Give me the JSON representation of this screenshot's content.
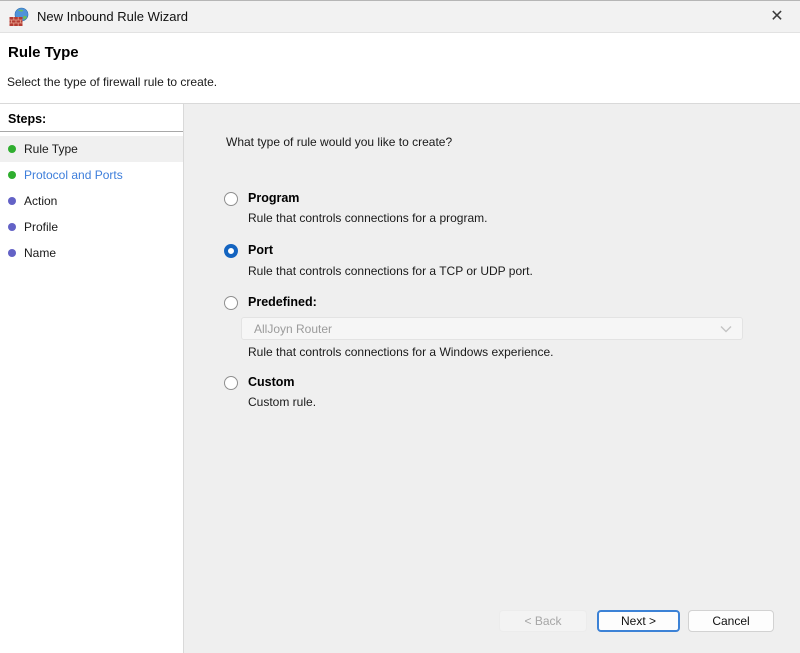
{
  "window": {
    "title": "New Inbound Rule Wizard",
    "close_glyph": "✕"
  },
  "header": {
    "title": "Rule Type",
    "subtitle": "Select the type of firewall rule to create."
  },
  "sidebar": {
    "heading": "Steps:",
    "steps": [
      {
        "label": "Rule Type",
        "bullet": "green",
        "state": "current"
      },
      {
        "label": "Protocol and Ports",
        "bullet": "green",
        "state": "link"
      },
      {
        "label": "Action",
        "bullet": "purple",
        "state": "upcoming"
      },
      {
        "label": "Profile",
        "bullet": "purple",
        "state": "upcoming"
      },
      {
        "label": "Name",
        "bullet": "purple",
        "state": "upcoming"
      }
    ]
  },
  "main": {
    "question": "What type of rule would you like to create?",
    "options": [
      {
        "label": "Program",
        "description": "Rule that controls connections for a program.",
        "selected": false
      },
      {
        "label": "Port",
        "description": "Rule that controls connections for a TCP or UDP port.",
        "selected": true
      },
      {
        "label": "Predefined:",
        "description": "Rule that controls connections for a Windows experience.",
        "selected": false,
        "dropdown": {
          "value": "AllJoyn Router",
          "disabled": true
        }
      },
      {
        "label": "Custom",
        "description": "Custom rule.",
        "selected": false
      }
    ]
  },
  "footer": {
    "back_label": "< Back",
    "next_label": "Next >",
    "cancel_label": "Cancel"
  },
  "colors": {
    "accent_blue": "#1464c0",
    "focus_border_blue": "#3c82d6",
    "link_blue": "#3d7edb",
    "bullet_green": "#2fae2f",
    "bullet_purple": "#6362c6",
    "content_bg": "#efefef",
    "disabled_text": "#9b9b9b"
  }
}
